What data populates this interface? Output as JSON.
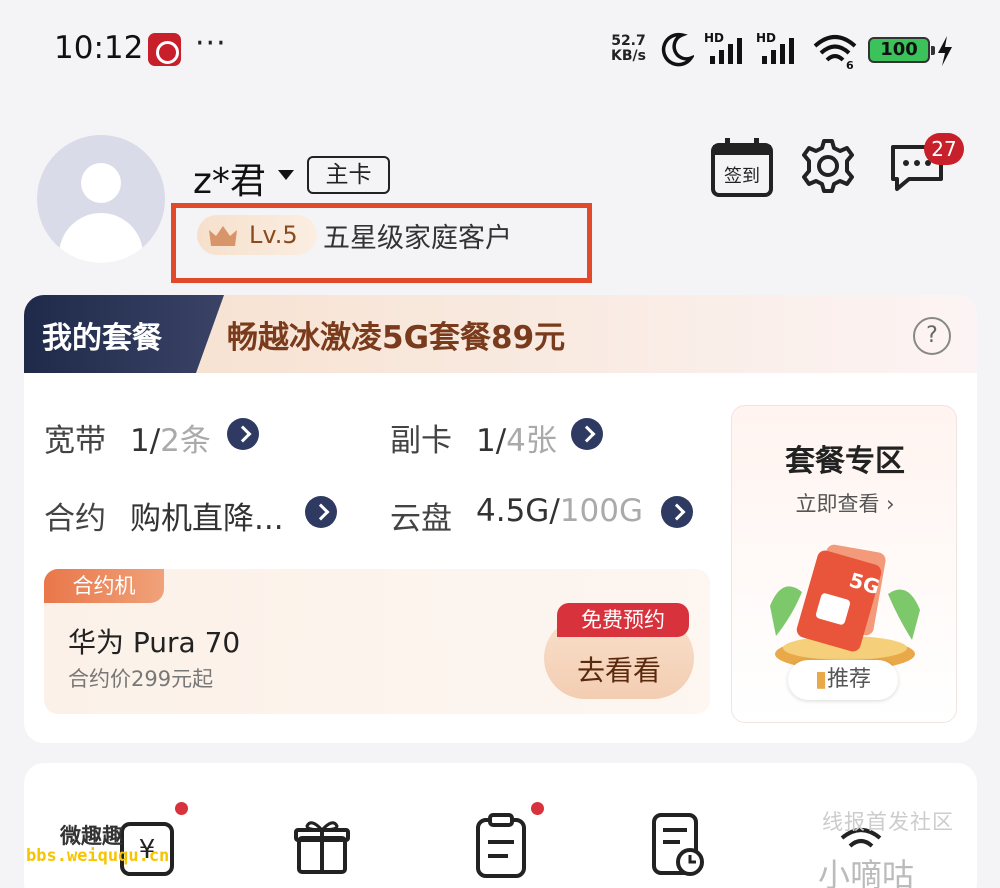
{
  "status_bar": {
    "time": "10:12",
    "dots": "···",
    "net_speed_value": "52.7",
    "net_speed_unit": "KB/s",
    "signal_label": "HD",
    "wifi_label": "6",
    "battery": "100"
  },
  "profile": {
    "name": "z*君",
    "card_type": "主卡",
    "level": "Lv.5",
    "level_title": "五星级家庭客户",
    "checkin_label": "签到",
    "message_count": "27"
  },
  "plan": {
    "tab_label": "我的套餐",
    "plan_name": "畅越冰激凌5G套餐89元",
    "help": "?",
    "broadband_label": "宽带",
    "broadband_used": "1/",
    "broadband_total": "2条",
    "subcard_label": "副卡",
    "subcard_used": "1/",
    "subcard_total": "4张",
    "contract_label": "合约",
    "contract_value": "购机直降...",
    "cloud_label": "云盘",
    "cloud_used": "4.5G/",
    "cloud_total": "100G",
    "contract_phone": {
      "tag": "合约机",
      "name": "华为 Pura 70",
      "price": "合约价299元起",
      "free_tag": "免费预约",
      "button": "去看看"
    },
    "zone": {
      "title": "套餐专区",
      "subtitle": "立即查看 ›",
      "badge": "5G",
      "recommend": "推荐"
    }
  },
  "watermark": {
    "forum": "线报首发社区",
    "brand": "小嘀咕",
    "site": "bbs.weiququ.cn",
    "site_logo": "微趣趣"
  },
  "colors": {
    "accent_red": "#c8202a",
    "highlight_box": "#e04a2a",
    "plan_navy": "#1f2a4a",
    "plan_brown": "#7a3a1c"
  }
}
